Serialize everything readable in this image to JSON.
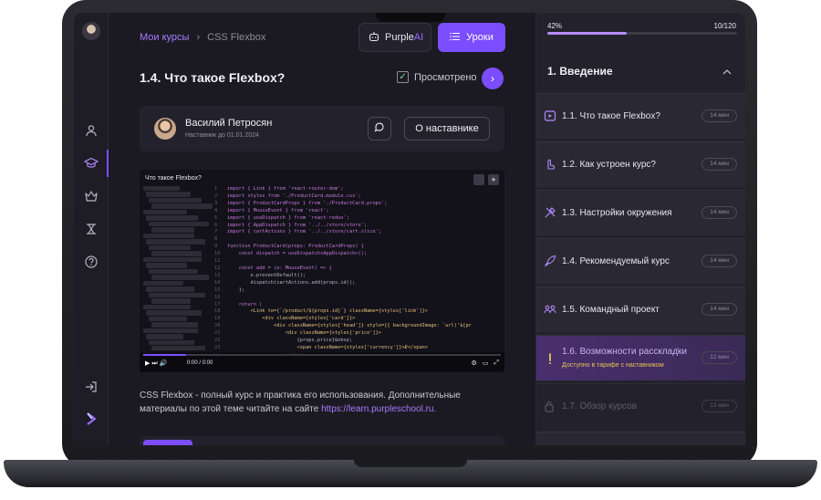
{
  "breadcrumb": {
    "root": "Мои курсы",
    "separator": "›",
    "current": "CSS Flexbox"
  },
  "header": {
    "ai_label_a": "Purple",
    "ai_label_b": "AI",
    "lessons_label": "Уроки"
  },
  "lesson": {
    "title": "1.4. Что такое Flexbox?",
    "viewed_label": "Просмотрено",
    "viewed": true
  },
  "mentor": {
    "name": "Василий Петросян",
    "subtitle": "Наставник до 01.01.2024",
    "about_label": "О наставнике"
  },
  "video": {
    "title": "Что такое Flexbox?",
    "time": "0:00 / 0:00",
    "progress": 0.12,
    "code_lines": [
      [
        "1",
        "import { Link } from 'react-router-dom';"
      ],
      [
        "2",
        "import styles from './ProductCard.module.css';"
      ],
      [
        "3",
        "import { ProductCardProps } from './ProductCard.props';"
      ],
      [
        "4",
        "import { MouseEvent } from 'react';"
      ],
      [
        "5",
        "import { useDispatch } from 'react-redux';"
      ],
      [
        "6",
        "import { AppDispatch } from '../../store/store';"
      ],
      [
        "7",
        "import { cartActions } from '../../store/cart.slice';"
      ],
      [
        "8",
        ""
      ],
      [
        "9",
        "function ProductCard(props: ProductCardProps) {"
      ],
      [
        "10",
        "    const dispatch = useDispatch<AppDispatch>();"
      ],
      [
        "11",
        ""
      ],
      [
        "12",
        "    const add = (e: MouseEvent) => {"
      ],
      [
        "13",
        "        e.preventDefault();"
      ],
      [
        "14",
        "        dispatch(cartActions.add(props.id));"
      ],
      [
        "15",
        "    };"
      ],
      [
        "16",
        ""
      ],
      [
        "17",
        "    return ("
      ],
      [
        "18",
        "        <Link to={`/product/${props.id}`} className={styles['link']}>"
      ],
      [
        "19",
        "            <div className={styles['card']}>"
      ],
      [
        "20",
        "                <div className={styles['head']} style={{ backgroundImage: `url('${pr"
      ],
      [
        "21",
        "                    <div className={styles['price']}>"
      ],
      [
        "22",
        "                        {props.price}&nbsp;"
      ],
      [
        "23",
        "                        <span className={styles['currency']}>₽</span>"
      ],
      [
        "24",
        "                    </div>"
      ]
    ]
  },
  "description": {
    "text": "CSS Flexbox - полный курс и практика его использования. Дополнительные материалы по этой теме читайте на сайте ",
    "link": "https://learn.purpleschool.ru."
  },
  "progress": {
    "percent": "42%",
    "count": "10/120",
    "fraction": 0.42
  },
  "section": {
    "title": "1. Введение"
  },
  "items": [
    {
      "label": "1.1. Что такое Flexbox?",
      "duration": "14 мин",
      "icon": "video-icon"
    },
    {
      "label": "1.2. Как устроен курс?",
      "duration": "14 мин",
      "icon": "pointer-icon"
    },
    {
      "label": "1.3. Настройки окружения",
      "duration": "14 мин",
      "icon": "tools-icon"
    },
    {
      "label": "1.4. Рекомендуемый курс",
      "duration": "14 мин",
      "icon": "rocket-icon"
    },
    {
      "label": "1.5. Командный проект",
      "duration": "14 мин",
      "icon": "team-icon"
    },
    {
      "label": "1.6. Возможности рассклад̇ки",
      "duration": "12 мин",
      "sub": "Доступно в тарифе с наставником",
      "icon": "alert-icon"
    },
    {
      "label": "1.7. Обзор курсов",
      "duration": "13 мин",
      "icon": "lock-icon"
    }
  ],
  "colors": {
    "accent": "#7b4dff",
    "background": "#1b1a22",
    "panel": "#23222c",
    "highlight_text": "#e8c25a"
  }
}
